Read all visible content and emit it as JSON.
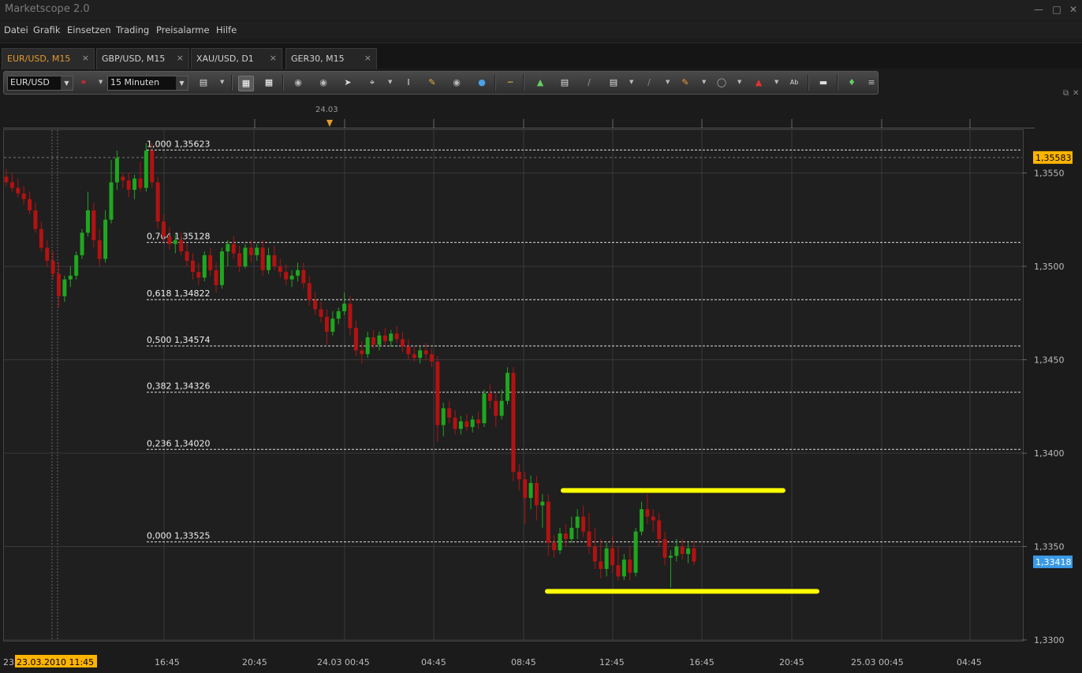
{
  "app": {
    "title": "Marketscope 2.0"
  },
  "menu": [
    "Datei",
    "Grafik",
    "Einsetzen",
    "Trading",
    "Preisalarme",
    "Hilfe"
  ],
  "tabs": [
    {
      "label": "EUR/USD, M15",
      "active": true
    },
    {
      "label": "GBP/USD, M15",
      "active": false
    },
    {
      "label": "XAU/USD, D1",
      "active": false
    },
    {
      "label": "GER30, M15",
      "active": false
    }
  ],
  "toolbar": {
    "symbol": "EUR/USD",
    "timeframe": "15 Minuten"
  },
  "chart_top_date": "24.03",
  "chart_data": {
    "type": "candlestick",
    "symbol": "EUR/USD",
    "period": "M15",
    "ylim": [
      1.33,
      1.3573
    ],
    "yticks": [
      1.355,
      1.35,
      1.345,
      1.34,
      1.335,
      1.33
    ],
    "ytick_labels": [
      "1,3550",
      "1,3500",
      "1,3450",
      "1,3400",
      "1,3350",
      "1,3300"
    ],
    "current_price_label": "1,35583",
    "current_price": 1.35583,
    "bid_price_label": "1,33418",
    "bid_price": 1.33418,
    "xtick_labels": [
      "16:45",
      "20:45",
      "24.03 00:45",
      "04:45",
      "08:45",
      "12:45",
      "16:45",
      "20:45",
      "25.03 00:45",
      "04:45"
    ],
    "cursor_date_label": "23.03.2010 11:45",
    "left_edge_label": "23",
    "fibonacci": [
      {
        "label": "1,000 1,35623",
        "price": 1.35623
      },
      {
        "label": "0,764 1,35128",
        "price": 1.35128
      },
      {
        "label": "0,618 1,34822",
        "price": 1.34822
      },
      {
        "label": "0,500 1,34574",
        "price": 1.34574
      },
      {
        "label": "0,382 1,34326",
        "price": 1.34326
      },
      {
        "label": "0,236 1,34020",
        "price": 1.3402
      },
      {
        "label": "0,000 1,33525",
        "price": 1.33525
      }
    ],
    "horizontal_lines": [
      {
        "from": "24.03 10:00",
        "to": "24.03 21:30",
        "price": 1.338,
        "color": "#ffff00"
      },
      {
        "from": "24.03 09:15",
        "to": "24.03 23:00",
        "price": 1.3326,
        "color": "#ffff00"
      }
    ],
    "candles_ohlc": [
      [
        1.3548,
        1.3552,
        1.3543,
        1.3545
      ],
      [
        1.3545,
        1.355,
        1.354,
        1.3542
      ],
      [
        1.3542,
        1.3547,
        1.3537,
        1.3539
      ],
      [
        1.3539,
        1.3543,
        1.3533,
        1.3536
      ],
      [
        1.3536,
        1.354,
        1.3528,
        1.353
      ],
      [
        1.353,
        1.3534,
        1.3518,
        1.352
      ],
      [
        1.352,
        1.3524,
        1.3508,
        1.351
      ],
      [
        1.351,
        1.3514,
        1.35,
        1.3503
      ],
      [
        1.3503,
        1.3508,
        1.3493,
        1.3496
      ],
      [
        1.3496,
        1.3502,
        1.3478,
        1.3484
      ],
      [
        1.3484,
        1.3495,
        1.3481,
        1.3493
      ],
      [
        1.3493,
        1.35,
        1.3489,
        1.3495
      ],
      [
        1.3495,
        1.3508,
        1.3493,
        1.3506
      ],
      [
        1.3506,
        1.352,
        1.3504,
        1.3518
      ],
      [
        1.3518,
        1.354,
        1.3516,
        1.353
      ],
      [
        1.353,
        1.3534,
        1.351,
        1.3514
      ],
      [
        1.3514,
        1.352,
        1.35,
        1.3504
      ],
      [
        1.3504,
        1.353,
        1.3502,
        1.3525
      ],
      [
        1.3525,
        1.3557,
        1.3523,
        1.3545
      ],
      [
        1.3545,
        1.3562,
        1.3541,
        1.3558
      ],
      [
        1.3548,
        1.355,
        1.3542,
        1.3546
      ],
      [
        1.3546,
        1.355,
        1.3537,
        1.3541
      ],
      [
        1.3541,
        1.3549,
        1.3536,
        1.3547
      ],
      [
        1.3547,
        1.3556,
        1.354,
        1.3542
      ],
      [
        1.3542,
        1.3566,
        1.354,
        1.3562
      ],
      [
        1.3562,
        1.3566,
        1.3542,
        1.3545
      ],
      [
        1.3545,
        1.3548,
        1.352,
        1.3524
      ],
      [
        1.3524,
        1.3528,
        1.3513,
        1.3516
      ],
      [
        1.3516,
        1.3521,
        1.3509,
        1.3512
      ],
      [
        1.3512,
        1.3517,
        1.3507,
        1.3514
      ],
      [
        1.3514,
        1.3518,
        1.3506,
        1.3508
      ],
      [
        1.3508,
        1.3512,
        1.35,
        1.3503
      ],
      [
        1.3503,
        1.3507,
        1.3493,
        1.3497
      ],
      [
        1.3497,
        1.3502,
        1.349,
        1.3494
      ],
      [
        1.3494,
        1.3508,
        1.3492,
        1.3506
      ],
      [
        1.3506,
        1.351,
        1.3495,
        1.3498
      ],
      [
        1.3498,
        1.3502,
        1.3486,
        1.349
      ],
      [
        1.349,
        1.351,
        1.3488,
        1.3508
      ],
      [
        1.3508,
        1.3514,
        1.35,
        1.3512
      ],
      [
        1.3512,
        1.3516,
        1.3504,
        1.3507
      ],
      [
        1.3507,
        1.3511,
        1.3497,
        1.35
      ],
      [
        1.35,
        1.3512,
        1.3499,
        1.351
      ],
      [
        1.351,
        1.3514,
        1.3502,
        1.3506
      ],
      [
        1.3506,
        1.3512,
        1.3503,
        1.351
      ],
      [
        1.351,
        1.3514,
        1.3495,
        1.3498
      ],
      [
        1.3498,
        1.351,
        1.3496,
        1.3506
      ],
      [
        1.3506,
        1.3511,
        1.3498,
        1.35
      ],
      [
        1.35,
        1.3504,
        1.3494,
        1.3497
      ],
      [
        1.3497,
        1.3501,
        1.349,
        1.3493
      ],
      [
        1.3493,
        1.3498,
        1.3489,
        1.3495
      ],
      [
        1.3495,
        1.3502,
        1.3492,
        1.3498
      ],
      [
        1.3498,
        1.3502,
        1.3488,
        1.3491
      ],
      [
        1.3491,
        1.3495,
        1.3479,
        1.3482
      ],
      [
        1.3482,
        1.3486,
        1.3474,
        1.3477
      ],
      [
        1.3477,
        1.3481,
        1.347,
        1.3473
      ],
      [
        1.3473,
        1.3477,
        1.3458,
        1.3465
      ],
      [
        1.3465,
        1.3476,
        1.3463,
        1.3472
      ],
      [
        1.3472,
        1.3478,
        1.3469,
        1.3476
      ],
      [
        1.3476,
        1.3486,
        1.3474,
        1.348
      ],
      [
        1.348,
        1.3484,
        1.3463,
        1.3467
      ],
      [
        1.3467,
        1.3471,
        1.3452,
        1.3455
      ],
      [
        1.3455,
        1.346,
        1.3448,
        1.3453
      ],
      [
        1.3453,
        1.3465,
        1.3451,
        1.3462
      ],
      [
        1.3462,
        1.3466,
        1.3456,
        1.3458
      ],
      [
        1.3458,
        1.3465,
        1.3455,
        1.3463
      ],
      [
        1.3463,
        1.3467,
        1.3458,
        1.346
      ],
      [
        1.346,
        1.3466,
        1.3457,
        1.3464
      ],
      [
        1.3464,
        1.3468,
        1.3459,
        1.3461
      ],
      [
        1.3461,
        1.3465,
        1.3454,
        1.3457
      ],
      [
        1.3457,
        1.3461,
        1.345,
        1.3453
      ],
      [
        1.3453,
        1.3457,
        1.3449,
        1.3451
      ],
      [
        1.3451,
        1.3457,
        1.3448,
        1.3455
      ],
      [
        1.3455,
        1.3459,
        1.345,
        1.3453
      ],
      [
        1.3453,
        1.3456,
        1.3446,
        1.3449
      ],
      [
        1.3449,
        1.3452,
        1.3406,
        1.3415
      ],
      [
        1.3415,
        1.3427,
        1.3409,
        1.3424
      ],
      [
        1.3424,
        1.3428,
        1.3416,
        1.3419
      ],
      [
        1.3419,
        1.3423,
        1.341,
        1.3413
      ],
      [
        1.3413,
        1.342,
        1.341,
        1.3417
      ],
      [
        1.3417,
        1.3421,
        1.3412,
        1.3414
      ],
      [
        1.3414,
        1.342,
        1.3411,
        1.3418
      ],
      [
        1.3418,
        1.3422,
        1.3413,
        1.3416
      ],
      [
        1.3416,
        1.3434,
        1.3414,
        1.3432
      ],
      [
        1.3432,
        1.3437,
        1.3424,
        1.3428
      ],
      [
        1.3428,
        1.3432,
        1.3414,
        1.342
      ],
      [
        1.342,
        1.3434,
        1.3418,
        1.3428
      ],
      [
        1.3428,
        1.3446,
        1.3426,
        1.3443
      ],
      [
        1.3443,
        1.3446,
        1.3385,
        1.339
      ],
      [
        1.339,
        1.3394,
        1.338,
        1.3386
      ],
      [
        1.3386,
        1.339,
        1.3362,
        1.3376
      ],
      [
        1.3376,
        1.3388,
        1.337,
        1.3384
      ],
      [
        1.3384,
        1.3388,
        1.3364,
        1.3372
      ],
      [
        1.3372,
        1.3378,
        1.336,
        1.3374
      ],
      [
        1.3374,
        1.3378,
        1.3345,
        1.3352
      ],
      [
        1.3352,
        1.3356,
        1.3344,
        1.3348
      ],
      [
        1.3348,
        1.336,
        1.3346,
        1.3357
      ],
      [
        1.3357,
        1.3362,
        1.335,
        1.3354
      ],
      [
        1.3354,
        1.3366,
        1.3352,
        1.336
      ],
      [
        1.336,
        1.337,
        1.3354,
        1.3366
      ],
      [
        1.3366,
        1.3372,
        1.3355,
        1.3358
      ],
      [
        1.3358,
        1.3368,
        1.3346,
        1.335
      ],
      [
        1.335,
        1.336,
        1.3338,
        1.3342
      ],
      [
        1.3342,
        1.3354,
        1.3333,
        1.3338
      ],
      [
        1.3338,
        1.3352,
        1.3334,
        1.3349
      ],
      [
        1.3349,
        1.3356,
        1.3336,
        1.334
      ],
      [
        1.334,
        1.335,
        1.3332,
        1.3334
      ],
      [
        1.3334,
        1.3346,
        1.3332,
        1.3343
      ],
      [
        1.3343,
        1.335,
        1.3332,
        1.3336
      ],
      [
        1.3336,
        1.336,
        1.3334,
        1.3358
      ],
      [
        1.3358,
        1.3374,
        1.3356,
        1.337
      ],
      [
        1.337,
        1.3378,
        1.3362,
        1.3366
      ],
      [
        1.3366,
        1.337,
        1.3358,
        1.3364
      ],
      [
        1.3364,
        1.3368,
        1.335,
        1.3354
      ],
      [
        1.3354,
        1.3358,
        1.334,
        1.3344
      ],
      [
        1.3344,
        1.3348,
        1.3328,
        1.3345
      ],
      [
        1.3345,
        1.3354,
        1.3342,
        1.335
      ],
      [
        1.335,
        1.3354,
        1.3343,
        1.3346
      ],
      [
        1.3346,
        1.3352,
        1.3341,
        1.3349
      ],
      [
        1.3349,
        1.3353,
        1.334,
        1.3342
      ]
    ]
  },
  "colors": {
    "bull": "#1fa71f",
    "bear": "#b31212",
    "fib": "#dddddd",
    "grid": "#3a3a3a",
    "accent": "#e39a2e",
    "current": "#ffb400",
    "bid": "#3a9ae6"
  }
}
